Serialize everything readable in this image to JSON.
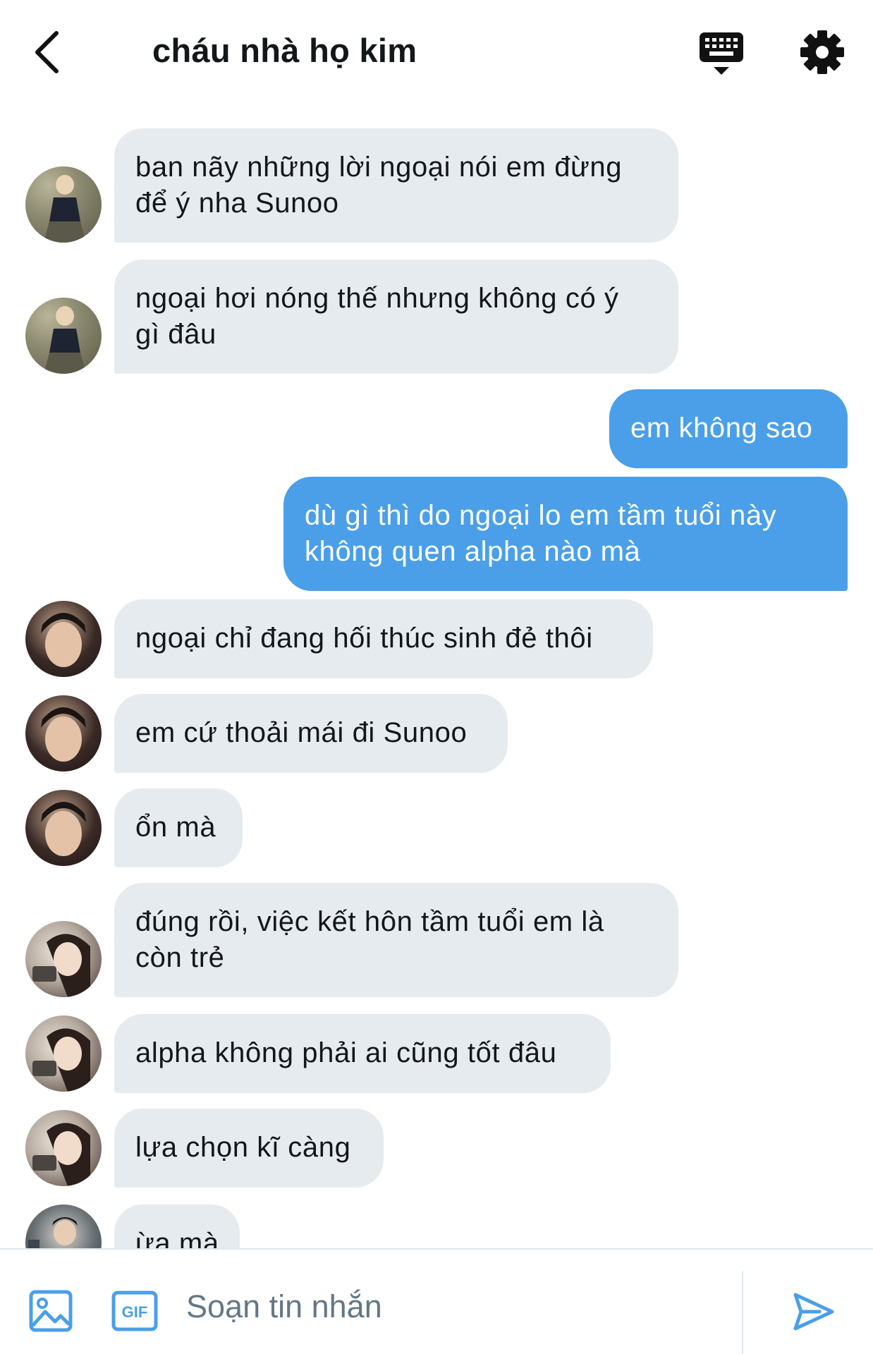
{
  "header": {
    "title": "cháu nhà họ kim"
  },
  "messages": [
    {
      "lines": [
        "ban nãy những lời ngoại nói em đừng",
        "để ý nha Sunoo"
      ]
    },
    {
      "lines": [
        "ngoại hơi nóng thế nhưng không có ý",
        "gì đâu"
      ]
    },
    {
      "lines": [
        "em không sao"
      ]
    },
    {
      "lines": [
        "dù gì thì do ngoại lo em tầm tuổi này",
        "không quen alpha nào mà"
      ]
    },
    {
      "lines": [
        "ngoại chỉ đang hối thúc sinh đẻ thôi"
      ]
    },
    {
      "lines": [
        "em cứ thoải mái đi Sunoo"
      ]
    },
    {
      "lines": [
        "ổn mà"
      ]
    },
    {
      "lines": [
        "đúng rồi, việc kết hôn tầm tuổi em là",
        "còn trẻ"
      ]
    },
    {
      "lines": [
        "alpha không phải ai cũng tốt đâu"
      ]
    },
    {
      "lines": [
        "lựa chọn kĩ càng"
      ]
    },
    {
      "lines": [
        "ừa mà"
      ]
    }
  ],
  "composer": {
    "placeholder": "Soạn tin nhắn",
    "gif_label": "GIF"
  },
  "icons": {
    "back": "chevron-left-icon",
    "keyboard": "keyboard-icon",
    "settings": "gear-icon",
    "image": "image-icon",
    "gif": "gif-icon",
    "send": "send-icon"
  },
  "colors": {
    "incoming_bubble": "#e6ebf0",
    "outgoing_bubble": "#4a9fe8",
    "accent": "#4a9fe8",
    "text": "#14171a",
    "placeholder": "#657786"
  }
}
